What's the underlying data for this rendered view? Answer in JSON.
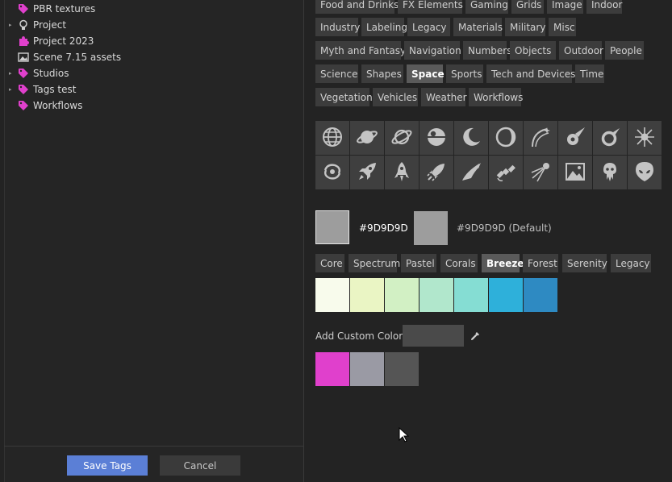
{
  "tree": {
    "items": [
      {
        "label": "PBR textures",
        "arrow": "",
        "icon": "tag-icon"
      },
      {
        "label": "Project",
        "arrow": "▸",
        "icon": "lightbulb-icon"
      },
      {
        "label": "Project 2023",
        "arrow": "",
        "icon": "puzzle-icon"
      },
      {
        "label": "Scene 7.15 assets",
        "arrow": "",
        "icon": "image-icon"
      },
      {
        "label": "Studios",
        "arrow": "▸",
        "icon": "tag-icon"
      },
      {
        "label": "Tags test",
        "arrow": "▸",
        "icon": "tag-icon"
      },
      {
        "label": "Workflows",
        "arrow": "",
        "icon": "tag-icon"
      }
    ]
  },
  "buttons": {
    "save": "Save Tags",
    "cancel": "Cancel"
  },
  "categories": [
    "Food and Drinks",
    "FX Elements",
    "Gaming",
    "Grids",
    "Image",
    "Indoor",
    "Industry",
    "Labeling",
    "Legacy",
    "Materials",
    "Military",
    "Misc",
    "Myth and Fantasy",
    "Navigation",
    "Numbers",
    "Objects",
    "Outdoor",
    "People",
    "Science",
    "Shapes",
    "Space",
    "Sports",
    "Tech and Devices",
    "Time",
    "Vegetation",
    "Vehicles",
    "Weather",
    "Workflows"
  ],
  "selected_category": "Space",
  "icons": [
    "globe-icon",
    "planet-icon",
    "orbit-planet-icon",
    "death-star-icon",
    "crescent-moon-icon",
    "moon-phase-icon",
    "comet-arc-icon",
    "meteor-icon",
    "meteor-ring-icon",
    "star-burst-icon",
    "galaxy-icon",
    "rocket-icon",
    "rocket-upright-icon",
    "rocket-launch-icon",
    "space-shuttle-icon",
    "satellite-icon",
    "sputnik-icon",
    "space-image-icon",
    "squid-alien-icon",
    "alien-head-icon"
  ],
  "color": {
    "current": "#9D9D9D",
    "default_label": "#9D9D9D (Default)"
  },
  "palettes": {
    "tabs": [
      "Core",
      "Spectrum",
      "Pastel",
      "Corals",
      "Breeze",
      "Forest",
      "Serenity",
      "Legacy"
    ],
    "selected": "Breeze",
    "colors": [
      "#f8fbec",
      "#eaf5c4",
      "#d2f0c4",
      "#b1e7cc",
      "#85ddd3",
      "#2eb0da",
      "#2e8ac2"
    ]
  },
  "custom": {
    "label": "Add Custom Color",
    "colors": [
      "#e040cc",
      "#9a9aa4",
      "#555555"
    ]
  }
}
